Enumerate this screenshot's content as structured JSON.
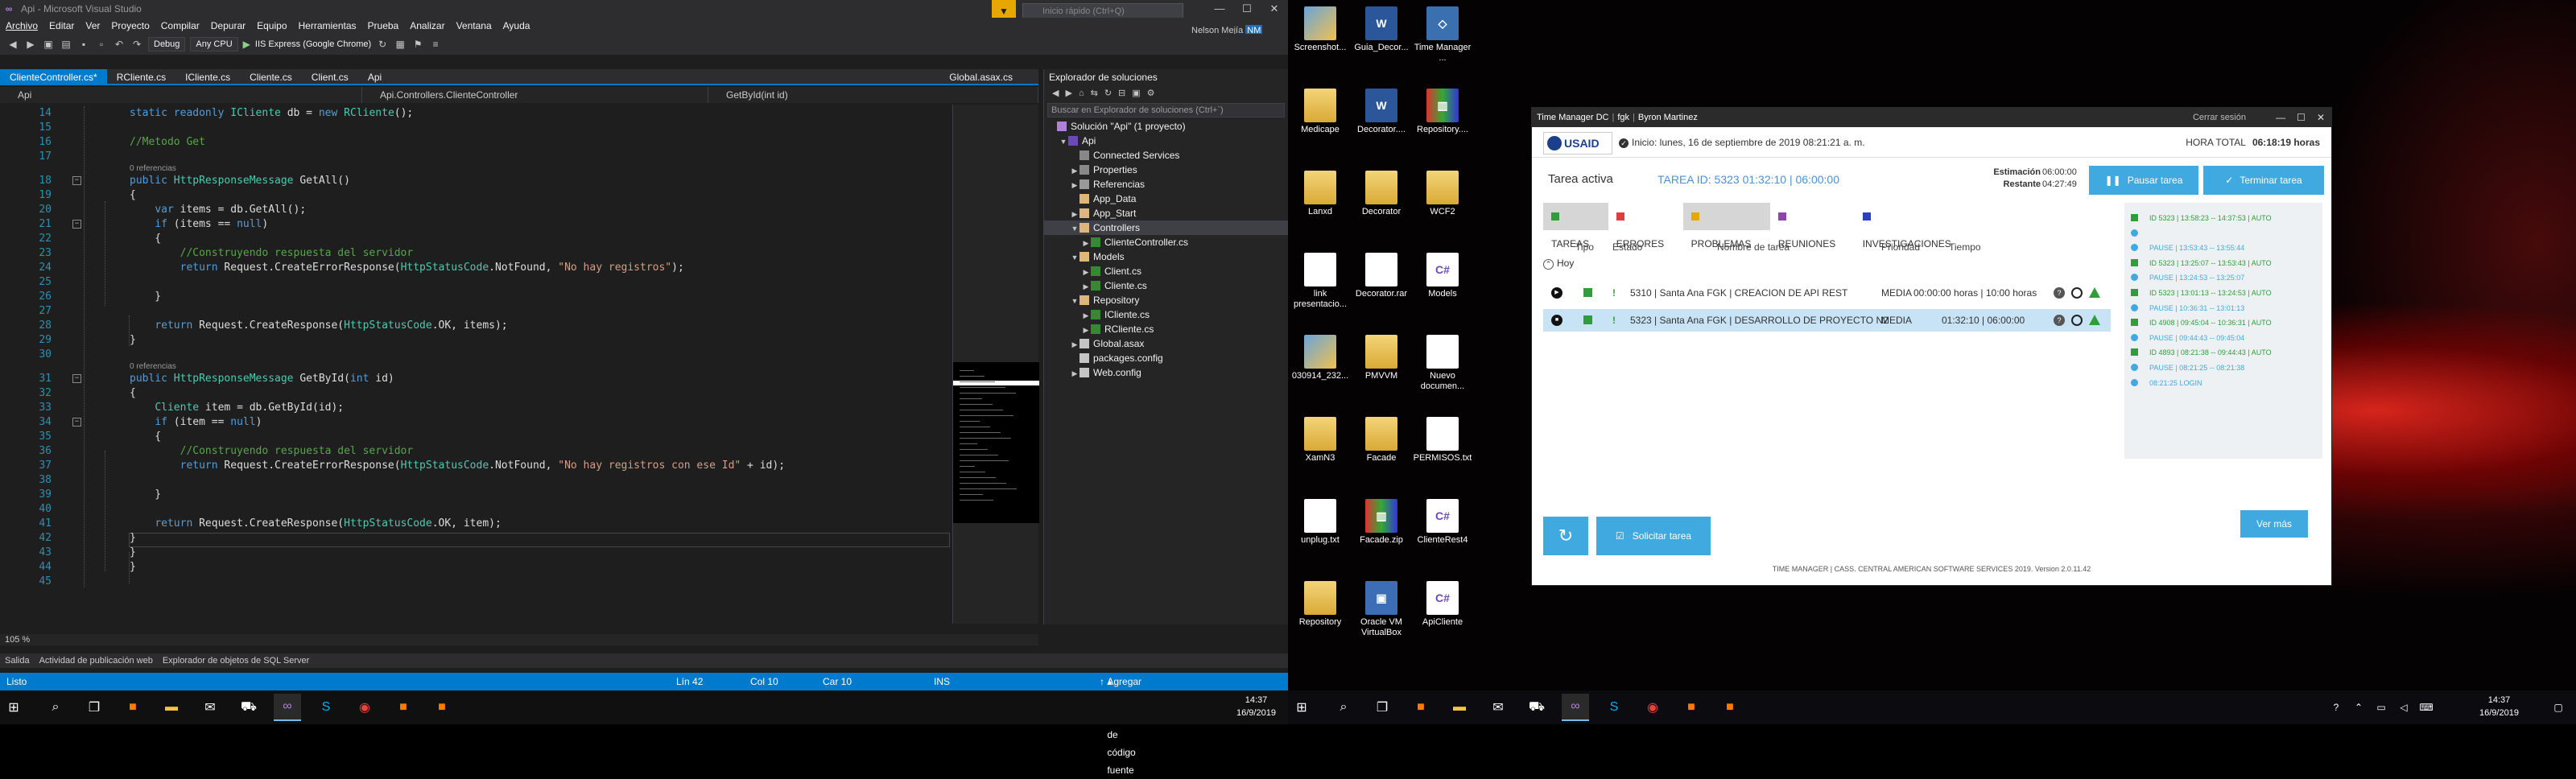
{
  "vs": {
    "title": "Api - Microsoft Visual Studio",
    "menu": [
      "Archivo",
      "Editar",
      "Ver",
      "Proyecto",
      "Compilar",
      "Depurar",
      "Equipo",
      "Herramientas",
      "Prueba",
      "Analizar",
      "Ventana",
      "Ayuda"
    ],
    "quick_launch_placeholder": "Inicio rápido (Ctrl+Q)",
    "user": "Nelson Mejía",
    "user_initials": "NM",
    "toolbar": {
      "config": "Debug",
      "platform": "Any CPU",
      "run_target": "IIS Express (Google Chrome)"
    },
    "tabs": [
      "ClienteController.cs*",
      "RCliente.cs",
      "ICliente.cs",
      "Cliente.cs",
      "Client.cs",
      "Api"
    ],
    "tab_right": "Global.asax.cs",
    "nav": {
      "project": "Api",
      "class": "Api.Controllers.ClienteController",
      "member": "GetById(int id)"
    },
    "code": [
      {
        "n": "14",
        "t": "static readonly ICliente db = new RCliente();",
        "c": "plain"
      },
      {
        "n": "15",
        "t": "",
        "c": "plain"
      },
      {
        "n": "16",
        "t": "//Metodo Get",
        "c": "comment"
      },
      {
        "n": "17",
        "t": "",
        "c": "plain"
      },
      {
        "n": "18",
        "t": "public HttpResponseMessage GetAll()",
        "c": "plain"
      },
      {
        "n": "19",
        "t": "{",
        "c": "plain"
      },
      {
        "n": "20",
        "t": "    var items = db.GetAll();",
        "c": "plain"
      },
      {
        "n": "21",
        "t": "    if (items == null)",
        "c": "plain"
      },
      {
        "n": "22",
        "t": "    {",
        "c": "plain"
      },
      {
        "n": "23",
        "t": "        //Construyendo respuesta del servidor",
        "c": "comment"
      },
      {
        "n": "24",
        "t": "        return Request.CreateErrorResponse(HttpStatusCode.NotFound, \"No hay registros\");",
        "c": "plain"
      },
      {
        "n": "25",
        "t": "",
        "c": "plain"
      },
      {
        "n": "26",
        "t": "    }",
        "c": "plain"
      },
      {
        "n": "27",
        "t": "",
        "c": "plain"
      },
      {
        "n": "28",
        "t": "    return Request.CreateResponse(HttpStatusCode.OK, items);",
        "c": "plain"
      },
      {
        "n": "29",
        "t": "}",
        "c": "plain"
      },
      {
        "n": "30",
        "t": "",
        "c": "plain"
      },
      {
        "n": "31",
        "t": "public HttpResponseMessage GetById(int id)",
        "c": "plain"
      },
      {
        "n": "32",
        "t": "{",
        "c": "plain"
      },
      {
        "n": "33",
        "t": "    Cliente item = db.GetById(id);",
        "c": "plain"
      },
      {
        "n": "34",
        "t": "    if (item == null)",
        "c": "plain"
      },
      {
        "n": "35",
        "t": "    {",
        "c": "plain"
      },
      {
        "n": "36",
        "t": "        //Construyendo respuesta del servidor",
        "c": "comment"
      },
      {
        "n": "37",
        "t": "        return Request.CreateErrorResponse(HttpStatusCode.NotFound, \"No hay registros con ese Id\" + id);",
        "c": "plain"
      },
      {
        "n": "38",
        "t": "",
        "c": "plain"
      },
      {
        "n": "39",
        "t": "    }",
        "c": "plain"
      },
      {
        "n": "40",
        "t": "",
        "c": "plain"
      },
      {
        "n": "41",
        "t": "    return Request.CreateResponse(HttpStatusCode.OK, item);",
        "c": "plain"
      },
      {
        "n": "42",
        "t": "}",
        "c": "plain"
      },
      {
        "n": "43",
        "t": "}",
        "c": "plain"
      },
      {
        "n": "44",
        "t": "}",
        "c": "plain"
      },
      {
        "n": "45",
        "t": "",
        "c": "plain"
      }
    ],
    "ref_hint": "0 referencias",
    "zoom": "105 %",
    "bottom_tabs": [
      "Salida",
      "Actividad de publicación web",
      "Explorador de objetos de SQL Server"
    ],
    "status": {
      "ready": "Listo",
      "line": "Lín 42",
      "col": "Col 10",
      "car": "Car 10",
      "ins": "INS",
      "source_control": "Agregar al control de código fuente"
    },
    "solution_explorer": {
      "title": "Explorador de soluciones",
      "search_placeholder": "Buscar en Explorador de soluciones (Ctrl+`)",
      "nodes": [
        {
          "label": "Solución \"Api\" (1 proyecto)",
          "level": 0,
          "icon": "sln",
          "arrow": ""
        },
        {
          "label": "Api",
          "level": 1,
          "icon": "proj",
          "arrow": "▼"
        },
        {
          "label": "Connected Services",
          "level": 2,
          "icon": "prop",
          "arrow": ""
        },
        {
          "label": "Properties",
          "level": 2,
          "icon": "prop",
          "arrow": "▶"
        },
        {
          "label": "Referencias",
          "level": 2,
          "icon": "ref",
          "arrow": "▶"
        },
        {
          "label": "App_Data",
          "level": 2,
          "icon": "folder",
          "arrow": ""
        },
        {
          "label": "App_Start",
          "level": 2,
          "icon": "folder",
          "arrow": "▶"
        },
        {
          "label": "Controllers",
          "level": 2,
          "icon": "folder",
          "arrow": "▼"
        },
        {
          "label": "ClienteController.cs",
          "level": 3,
          "icon": "cs",
          "arrow": "▶"
        },
        {
          "label": "Models",
          "level": 2,
          "icon": "folder",
          "arrow": "▼"
        },
        {
          "label": "Client.cs",
          "level": 3,
          "icon": "cs",
          "arrow": "▶"
        },
        {
          "label": "Cliente.cs",
          "level": 3,
          "icon": "cs",
          "arrow": "▶"
        },
        {
          "label": "Repository",
          "level": 2,
          "icon": "folder",
          "arrow": "▼"
        },
        {
          "label": "ICliente.cs",
          "level": 3,
          "icon": "cs",
          "arrow": "▶"
        },
        {
          "label": "RCliente.cs",
          "level": 3,
          "icon": "cs",
          "arrow": "▶"
        },
        {
          "label": "Global.asax",
          "level": 2,
          "icon": "file",
          "arrow": "▶"
        },
        {
          "label": "packages.config",
          "level": 2,
          "icon": "file",
          "arrow": ""
        },
        {
          "label": "Web.config",
          "level": 2,
          "icon": "file",
          "arrow": "▶"
        }
      ],
      "selected_index": 7
    }
  },
  "desktop_icons": [
    {
      "label": "Screenshot...",
      "glyph": "img"
    },
    {
      "label": "Guia_Decor...",
      "glyph": "word"
    },
    {
      "label": "Time Manager ...",
      "glyph": "tm"
    },
    {
      "label": "Medicape",
      "glyph": "folder"
    },
    {
      "label": "Decorator....",
      "glyph": "word"
    },
    {
      "label": "Repository....",
      "glyph": "zip"
    },
    {
      "label": "Lanxd",
      "glyph": "folder"
    },
    {
      "label": "Decorator",
      "glyph": "folder"
    },
    {
      "label": "WCF2",
      "glyph": "folder"
    },
    {
      "label": "link presentacio...",
      "glyph": "doc"
    },
    {
      "label": "Decorator.rar",
      "glyph": "doc"
    },
    {
      "label": "Models",
      "glyph": "cs"
    },
    {
      "label": "030914_232...",
      "glyph": "img"
    },
    {
      "label": "PMVVM",
      "glyph": "folder"
    },
    {
      "label": "Nuevo documen...",
      "glyph": "doc"
    },
    {
      "label": "XamN3",
      "glyph": "folder"
    },
    {
      "label": "Facade",
      "glyph": "folder"
    },
    {
      "label": "PERMISOS.txt",
      "glyph": "doc"
    },
    {
      "label": "unplug.txt",
      "glyph": "doc"
    },
    {
      "label": "Facade.zip",
      "glyph": "zip"
    },
    {
      "label": "ClienteRest4",
      "glyph": "cs"
    },
    {
      "label": "Repository",
      "glyph": "folder"
    },
    {
      "label": "Oracle VM VirtualBox",
      "glyph": "vm"
    },
    {
      "label": "ApiCliente",
      "glyph": "cs"
    }
  ],
  "time_manager": {
    "title_app": "Time Manager DC",
    "title_user_code": "fgk",
    "title_user": "Byron Martinez",
    "logout": "Cerrar sesión",
    "logo": "USAID",
    "start": "Inicio: lunes, 16 de septiembre de 2019 08:21:21 a. m.",
    "total_label": "HORA TOTAL",
    "total_value": "06:18:19 horas",
    "active_label": "Tarea activa",
    "active_value": "TAREA ID: 5323   01:32:10  |  06:00:00",
    "estimate_label": "Estimación",
    "estimate_value": "06:00:00",
    "remaining_label": "Restante",
    "remaining_value": "04:27:49",
    "pause_btn": "Pausar tarea",
    "finish_btn": "Terminar tarea",
    "tabs": [
      {
        "label": "TAREAS",
        "color": "#2e9d3a",
        "active": true
      },
      {
        "label": "ERRORES",
        "color": "#e33c3c",
        "active": false
      },
      {
        "label": "PROBLEMAS",
        "color": "#e8a600",
        "active": true
      },
      {
        "label": "REUNIONES",
        "color": "#8e44ad",
        "active": false
      },
      {
        "label": "INVESTIGACIONES",
        "color": "#2b3fbf",
        "active": false
      }
    ],
    "columns": [
      "Tipo",
      "Estado",
      "Nombre de tarea",
      "Prioridad",
      "Tiempo"
    ],
    "group": "Hoy",
    "rows": [
      {
        "name": "5310 | Santa Ana FGK | CREACION DE API REST",
        "priority": "MEDIA",
        "time": "00:00:00 horas  |  10:00 horas",
        "selected": false,
        "play": "▶"
      },
      {
        "name": "5323 | Santa Ana FGK | DESARROLLO DE PROYECTO N2",
        "priority": "MEDIA",
        "time": "01:32:10  |  06:00:00",
        "selected": true,
        "play": "■"
      }
    ],
    "log": [
      {
        "t": "ID 5323  |  13:58:23 -- 14:37:53  |  AUTO",
        "k": "g"
      },
      {
        "t": "",
        "k": "b"
      },
      {
        "t": "PAUSE  |  13:53:43 -- 13:55:44",
        "k": "b"
      },
      {
        "t": "ID 5323  |  13:25:07 -- 13:53:43  |  AUTO",
        "k": "g"
      },
      {
        "t": "PAUSE  |  13:24:53 -- 13:25:07",
        "k": "b"
      },
      {
        "t": "ID 5323  |  13:01:13 -- 13:24:53  |  AUTO",
        "k": "g"
      },
      {
        "t": "PAUSE  |  10:36:31 -- 13:01:13",
        "k": "b"
      },
      {
        "t": "ID 4908  |  09:45:04 -- 10:36:31  |  AUTO",
        "k": "g"
      },
      {
        "t": "PAUSE  |  09:44:43 -- 09:45:04",
        "k": "b"
      },
      {
        "t": "ID 4893  |  08:21:38 -- 09:44:43  |  AUTO",
        "k": "g"
      },
      {
        "t": "PAUSE  |  08:21:25 -- 08:21:38",
        "k": "b"
      },
      {
        "t": "08:21:25  LOGIN",
        "k": "b"
      }
    ],
    "request_btn": "Solicitar tarea",
    "more_btn": "Ver más",
    "footer": "TIME MANAGER | CASS. CENTRAL AMERICAN SOFTWARE SERVICES 2019. Version 2.0.11.42"
  },
  "clock": {
    "time": "14:37",
    "date": "16/9/2019"
  }
}
